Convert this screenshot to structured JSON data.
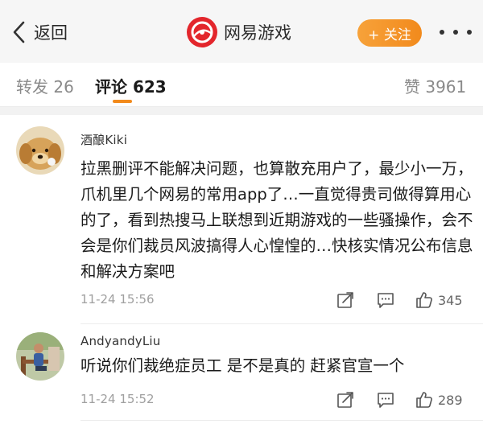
{
  "header": {
    "back_label": "返回",
    "brand_name": "网易游戏",
    "follow_label": "+ 关注"
  },
  "tabs": {
    "repost": "转发 26",
    "comments": "评论 623",
    "likes": "赞 3961"
  },
  "comments": [
    {
      "username": "酒酿Kiki",
      "text": "拉黑删评不能解决问题，也算散充用户了，最少小一万，爪机里几个网易的常用app了…一直觉得贵司做得算用心的了，看到热搜马上联想到近期游戏的一些骚操作，会不会是你们裁员风波搞得人心惶惶的…快核实情况公布信息和解决方案吧",
      "time": "11-24 15:56",
      "likes": "345"
    },
    {
      "username": "AndyandyLiu",
      "text": "听说你们裁绝症员工 是不是真的 赶紧官宣一个",
      "time": "11-24 15:52",
      "likes": "289"
    }
  ],
  "icons": {
    "back": "chevron-left-icon",
    "brand": "netease-logo-icon",
    "share": "share-icon",
    "reply": "comment-icon",
    "like": "thumbs-up-icon"
  },
  "colors": {
    "accent": "#f28a1c",
    "brand": "#e3262c"
  }
}
